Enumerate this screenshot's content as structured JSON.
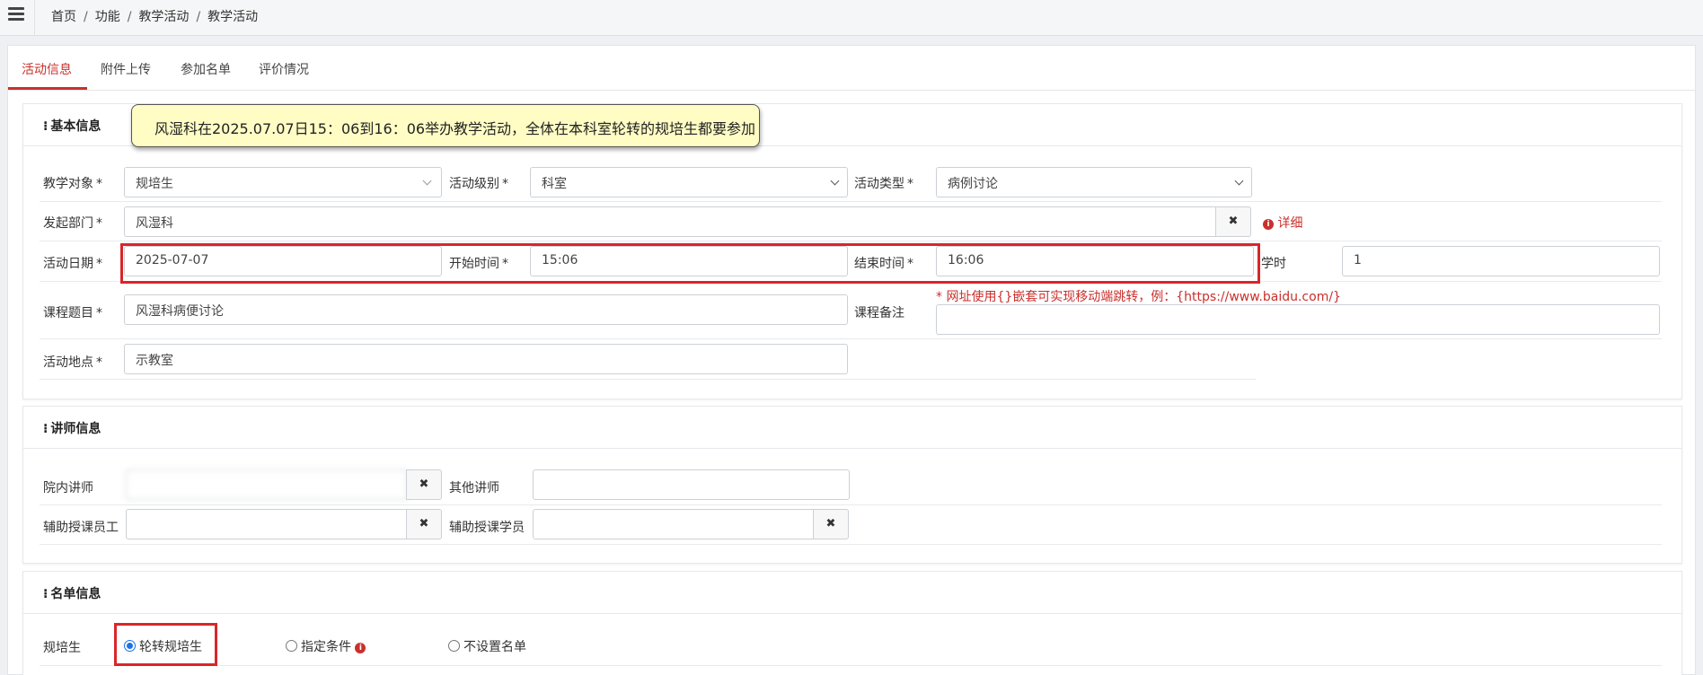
{
  "breadcrumb": [
    "首页",
    "功能",
    "教学活动",
    "教学活动"
  ],
  "tabs": [
    "活动信息",
    "附件上传",
    "参加名单",
    "评价情况"
  ],
  "tooltip": "风湿科在2025.07.07日15：06到16：06举办教学活动，全体在本科室轮转的规培生都要参加",
  "basic": {
    "title": "基本信息",
    "target_label": "教学对象",
    "target_value": "规培生",
    "level_label": "活动级别",
    "level_value": "科室",
    "type_label": "活动类型",
    "type_value": "病例讨论",
    "dept_label": "发起部门",
    "dept_value": "风湿科",
    "detail_link": "详细",
    "date_label": "活动日期",
    "date_value": "2025-07-07",
    "start_label": "开始时间",
    "start_value": "15:06",
    "end_label": "结束时间",
    "end_value": "16:06",
    "hours_label": "学时",
    "hours_value": "1",
    "topic_label": "课程题目",
    "topic_value": "风湿科病便讨论",
    "note_label": "课程备注",
    "note_hint": "* 网址使用{}嵌套可实现移动端跳转，例：{https://www.baidu.com/}",
    "note_value": "",
    "place_label": "活动地点",
    "place_value": "示教室",
    "required_mark": "*"
  },
  "lecturer": {
    "title": "讲师信息",
    "internal_label": "院内讲师",
    "internal_value": "　　",
    "other_label": "其他讲师",
    "other_value": "",
    "assist_staff_label": "辅助授课员工",
    "assist_staff_value": "",
    "assist_student_label": "辅助授课学员",
    "assist_student_value": ""
  },
  "roster": {
    "title": "名单信息",
    "row_label": "规培生",
    "options": [
      "轮转规培生",
      "指定条件",
      "不设置名单"
    ],
    "selected": 0
  },
  "icons": {
    "clear": "✖",
    "info": "i"
  },
  "colors": {
    "accent": "#c9302c",
    "highlight_box": "#d9262a",
    "tooltip_bg": "#fffdc4",
    "radio_selected": "#1a73e8"
  }
}
